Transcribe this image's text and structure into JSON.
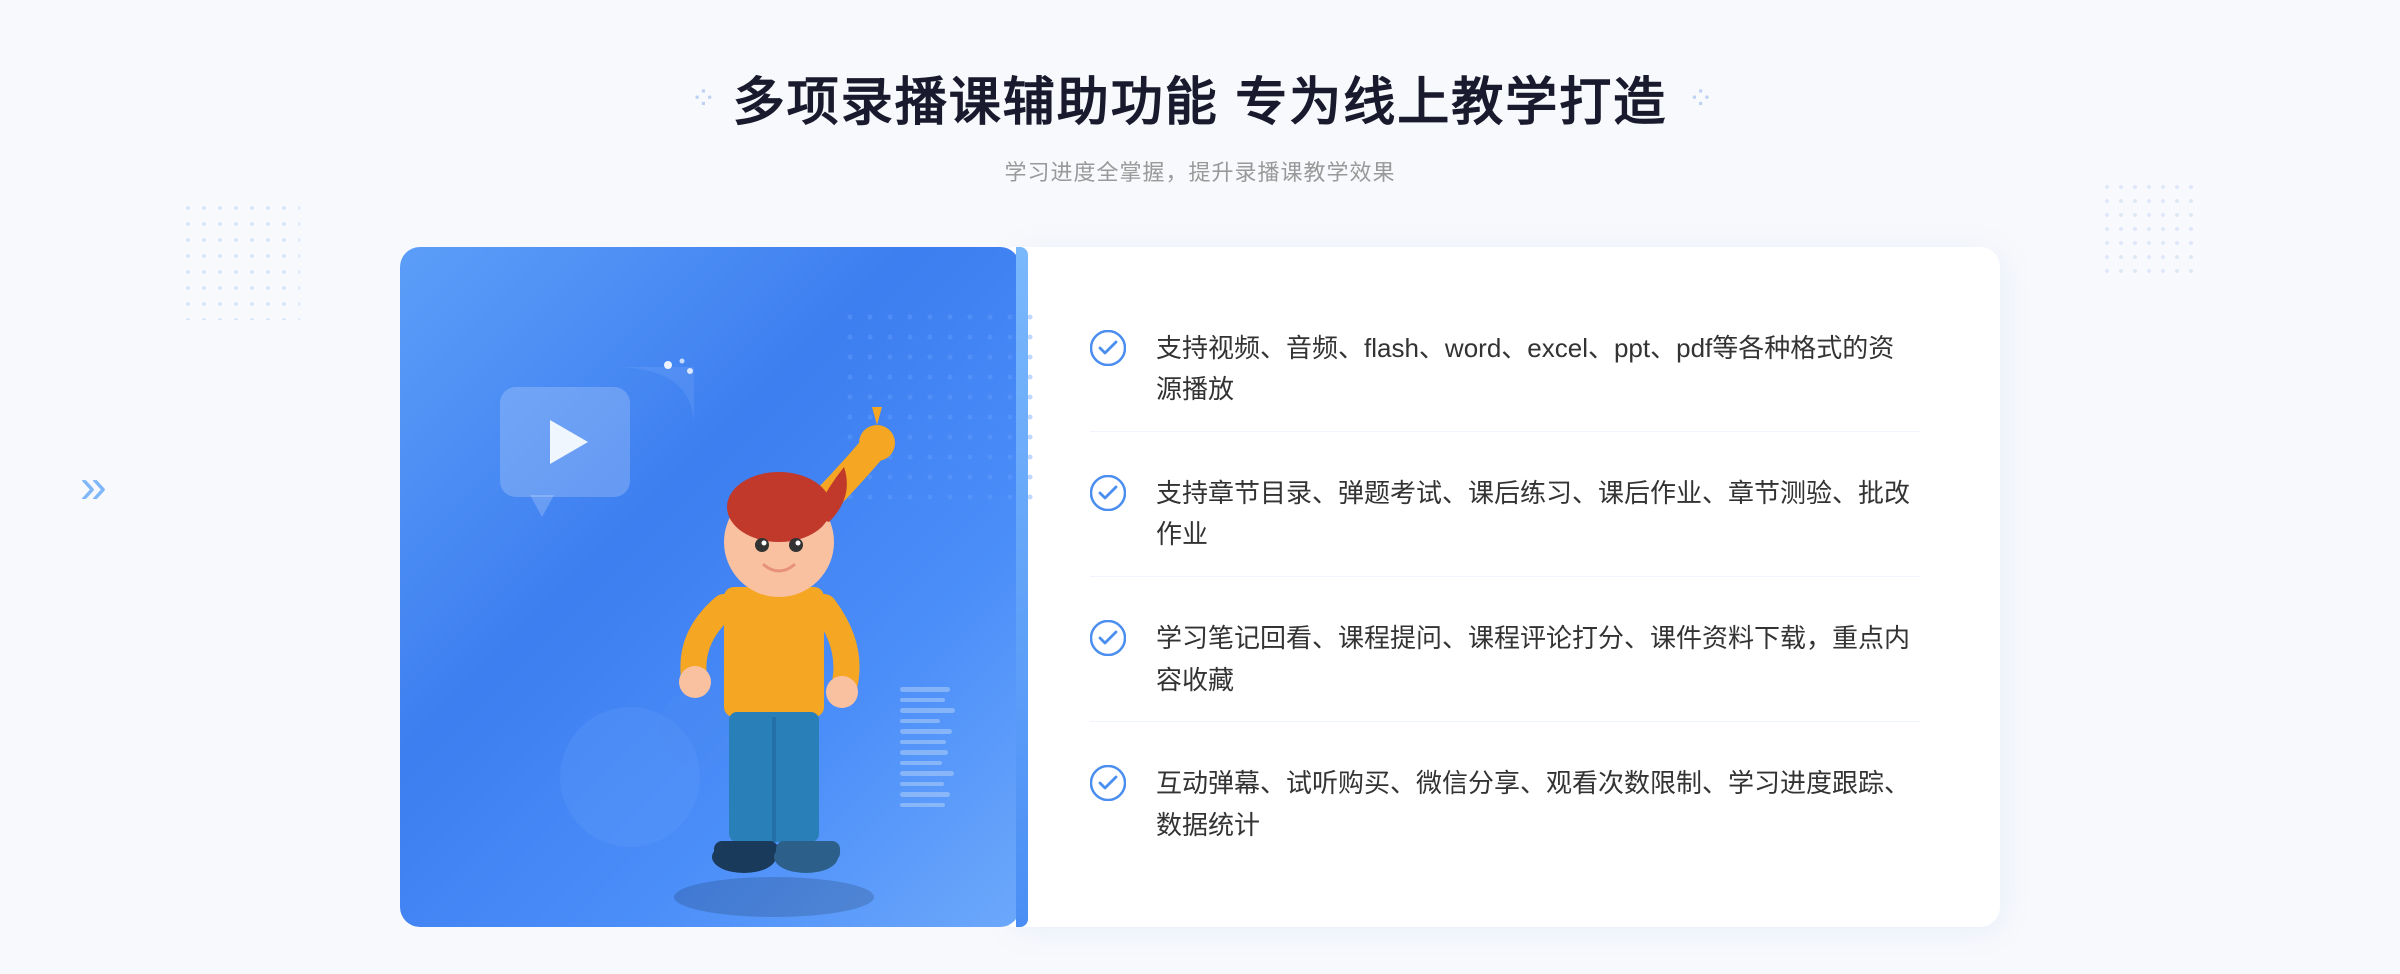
{
  "header": {
    "decorator_left": "⁘",
    "decorator_right": "⁘",
    "title": "多项录播课辅助功能 专为线上教学打造",
    "subtitle": "学习进度全掌握，提升录播课教学效果"
  },
  "features": [
    {
      "id": "feature-1",
      "text": "支持视频、音频、flash、word、excel、ppt、pdf等各种格式的资源播放"
    },
    {
      "id": "feature-2",
      "text": "支持章节目录、弹题考试、课后练习、课后作业、章节测验、批改作业"
    },
    {
      "id": "feature-3",
      "text": "学习笔记回看、课程提问、课程评论打分、课件资料下载，重点内容收藏"
    },
    {
      "id": "feature-4",
      "text": "互动弹幕、试听购买、微信分享、观看次数限制、学习进度跟踪、数据统计"
    }
  ],
  "colors": {
    "primary": "#4a8ef0",
    "check_color": "#4a8ef0",
    "title_color": "#1a1a2e",
    "text_color": "#333333",
    "subtitle_color": "#999999"
  }
}
